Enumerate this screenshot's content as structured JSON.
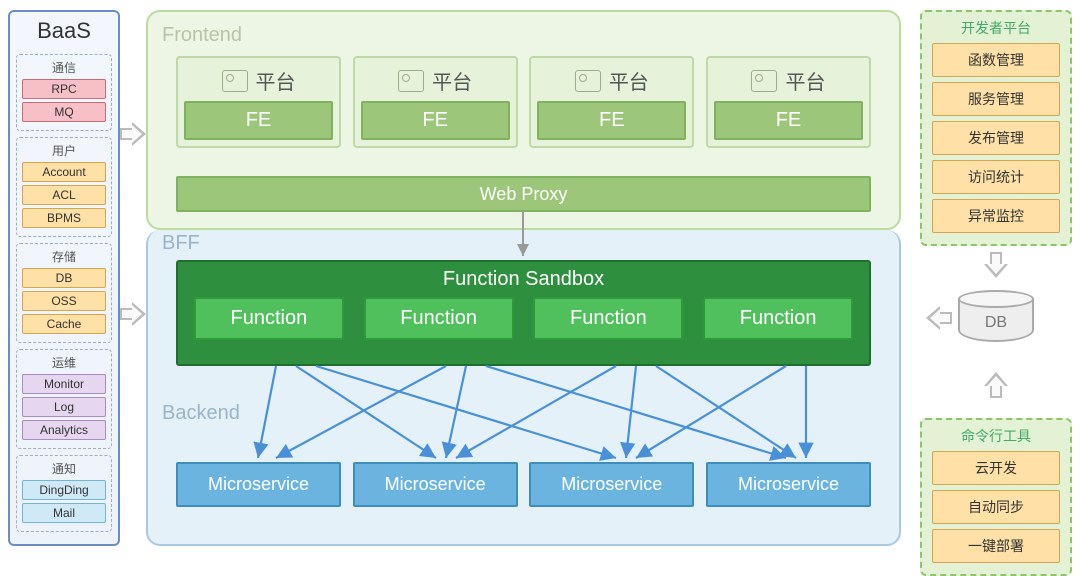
{
  "baas": {
    "title": "BaaS",
    "groups": [
      {
        "title": "通信",
        "items": [
          {
            "label": "RPC",
            "color": "c-red"
          },
          {
            "label": "MQ",
            "color": "c-red"
          }
        ]
      },
      {
        "title": "用户",
        "items": [
          {
            "label": "Account",
            "color": "c-orange"
          },
          {
            "label": "ACL",
            "color": "c-orange"
          },
          {
            "label": "BPMS",
            "color": "c-orange"
          }
        ]
      },
      {
        "title": "存储",
        "items": [
          {
            "label": "DB",
            "color": "c-orange"
          },
          {
            "label": "OSS",
            "color": "c-orange"
          },
          {
            "label": "Cache",
            "color": "c-orange"
          }
        ]
      },
      {
        "title": "运维",
        "items": [
          {
            "label": "Monitor",
            "color": "c-purple"
          },
          {
            "label": "Log",
            "color": "c-purple"
          },
          {
            "label": "Analytics",
            "color": "c-purple"
          }
        ]
      },
      {
        "title": "通知",
        "items": [
          {
            "label": "DingDing",
            "color": "c-blue"
          },
          {
            "label": "Mail",
            "color": "c-blue"
          }
        ]
      }
    ]
  },
  "main": {
    "frontend_label": "Frontend",
    "bff_label": "BFF",
    "backend_label": "Backend",
    "platform_name": "平台",
    "fe_label": "FE",
    "webproxy": "Web Proxy",
    "sandbox_title": "Function Sandbox",
    "function_label": "Function",
    "microservice_label": "Microservice"
  },
  "right": {
    "devplat_title": "开发者平台",
    "dev_items": [
      "函数管理",
      "服务管理",
      "发布管理",
      "访问统计",
      "异常监控"
    ],
    "db_label": "DB",
    "cli_title": "命令行工具",
    "cli_items": [
      "云开发",
      "自动同步",
      "一键部署"
    ]
  }
}
